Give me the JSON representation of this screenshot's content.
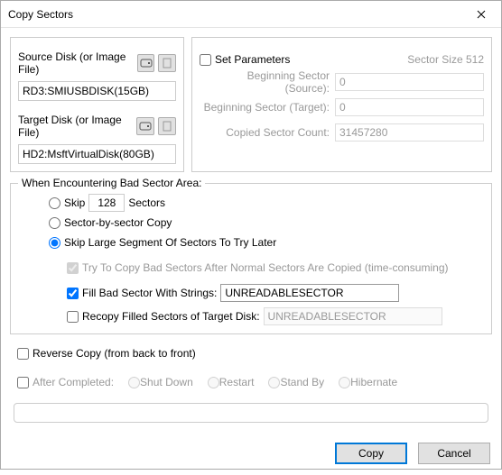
{
  "title": "Copy Sectors",
  "source": {
    "label": "Source Disk (or Image File)",
    "value": "RD3:SMIUSBDISK(15GB)"
  },
  "target": {
    "label": "Target Disk (or Image File)",
    "value": "HD2:MsftVirtualDisk(80GB)"
  },
  "params": {
    "set_label": "Set Parameters",
    "sector_size_label": "Sector Size 512",
    "begin_src_label": "Beginning Sector (Source):",
    "begin_src_val": "0",
    "begin_tgt_label": "Beginning Sector (Target):",
    "begin_tgt_val": "0",
    "count_label": "Copied Sector Count:",
    "count_val": "31457280"
  },
  "bad": {
    "title": "When Encountering Bad Sector Area:",
    "skip_label": "Skip",
    "skip_n": "128",
    "skip_unit": "Sectors",
    "sbs_label": "Sector-by-sector Copy",
    "large_label": "Skip Large Segment Of Sectors To Try Later",
    "try_later_label": "Try To Copy Bad Sectors After Normal Sectors Are Copied (time-consuming)",
    "fill_label": "Fill Bad Sector With Strings:",
    "fill_val": "UNREADABLESECTOR",
    "recopy_label": "Recopy Filled Sectors of Target Disk:",
    "recopy_val": "UNREADABLESECTOR"
  },
  "reverse_label": "Reverse Copy (from back to front)",
  "after": {
    "label": "After Completed:",
    "shut": "Shut Down",
    "restart": "Restart",
    "standby": "Stand By",
    "hibernate": "Hibernate"
  },
  "buttons": {
    "copy": "Copy",
    "cancel": "Cancel"
  }
}
